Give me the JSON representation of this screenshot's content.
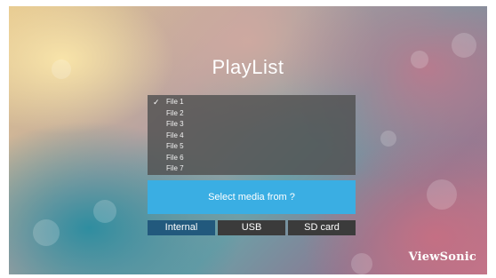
{
  "screen": {
    "title": "PlayList",
    "brand": "ViewSonic",
    "background_colors": [
      "#e6c88e",
      "#6e9ea6",
      "#c0788d"
    ]
  },
  "file_list": {
    "items": [
      {
        "label": "File 1",
        "checked": true
      },
      {
        "label": "File 2",
        "checked": false
      },
      {
        "label": "File 3",
        "checked": false
      },
      {
        "label": "File 4",
        "checked": false
      },
      {
        "label": "File 5",
        "checked": false
      },
      {
        "label": "File 6",
        "checked": false
      },
      {
        "label": "File 7",
        "checked": false
      }
    ],
    "check_glyph": "✓",
    "panel_color": "#505050"
  },
  "select_media": {
    "prompt": "Select media from ?",
    "panel_color": "#3aaee3"
  },
  "sources": {
    "items": [
      {
        "label": "Internal",
        "selected": true
      },
      {
        "label": "USB",
        "selected": false
      },
      {
        "label": "SD card",
        "selected": false
      }
    ],
    "selected_color": "#22597d",
    "default_color": "#3b3b3b"
  }
}
